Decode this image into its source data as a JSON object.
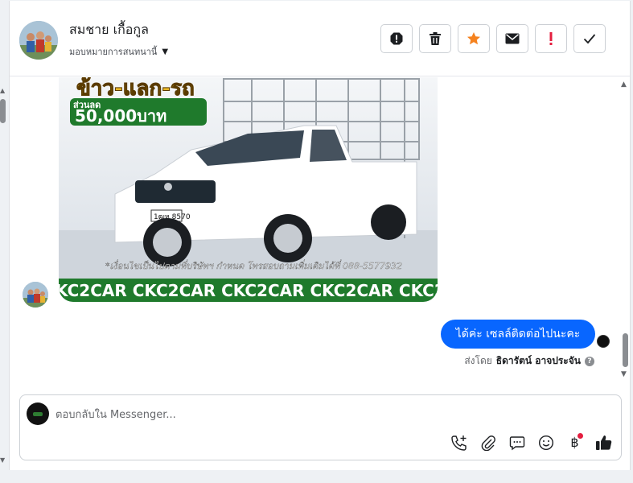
{
  "contact": {
    "name": "สมชาย เกื้อกูล",
    "assign_label": "มอบหมายการสนทนานี้"
  },
  "header_actions": [
    {
      "name": "report-icon",
      "color": "#1c1e21"
    },
    {
      "name": "trash-icon",
      "color": "#1c1e21"
    },
    {
      "name": "star-icon",
      "color": "#f5821f"
    },
    {
      "name": "envelope-icon",
      "color": "#1c1e21"
    },
    {
      "name": "exclamation-icon",
      "color": "#e41e3f"
    },
    {
      "name": "checkmark-icon",
      "color": "#1c1e21"
    }
  ],
  "image_message": {
    "promo_line1": "ข้าว-แลก-รถ",
    "promo_line2": "ส่วนลด",
    "promo_amount": "50,000บาท",
    "plate": "1ฒห 8570",
    "footer_note": "*เงื่อนไขเป็นไปตามที่บริษัทฯ กำหนด โทรสอบถามเพิ่มเติมได้ที่ 088-5577932",
    "banner_text": "KC2CAR CKC2CAR CKC2CAR CKC2CAR CKC2"
  },
  "reply_message": {
    "text": "ได้ค่ะ เซลล์ติดต่อไปนะคะ",
    "sent_by_prefix": "ส่งโดย",
    "sent_by_name": "ธิดารัตน์ อาจประจัน"
  },
  "composer": {
    "placeholder": "ตอบกลับใน Messenger...",
    "tools": [
      "phone-add-icon",
      "paperclip-icon",
      "speech-bubble-icon",
      "smiley-icon",
      "baht-icon",
      "thumbs-up-icon"
    ],
    "baht_symbol": "฿"
  },
  "colors": {
    "brand_blue": "#0866ff",
    "alert_red": "#e41e3f",
    "star_orange": "#f5821f"
  }
}
